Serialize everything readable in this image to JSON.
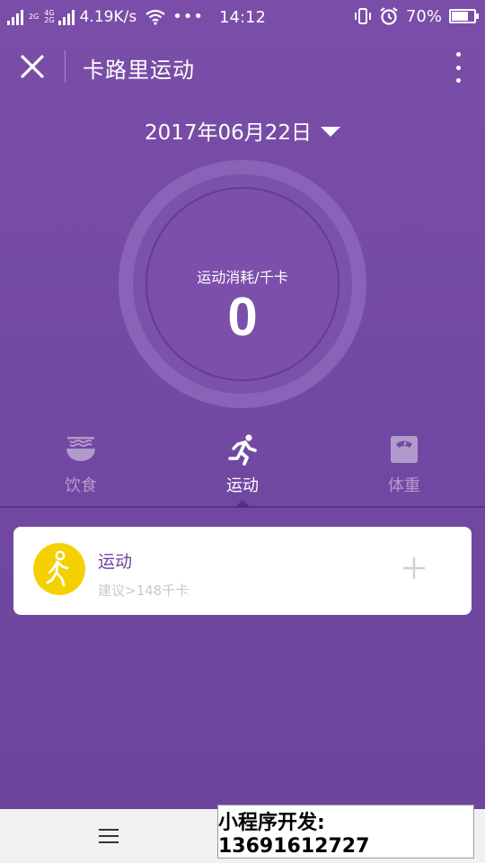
{
  "status_bar": {
    "net_top": "2G",
    "net_mid": "4G",
    "net_bot": "2G",
    "speed": "4.19K/s",
    "more": "•••",
    "time": "14:12",
    "battery_percent": "70%",
    "battery_level": 0.7
  },
  "nav": {
    "title": "卡路里运动"
  },
  "date": {
    "text": "2017年06月22日"
  },
  "ring": {
    "label": "运动消耗/千卡",
    "value": "0"
  },
  "tabs": [
    {
      "label": "饮食",
      "icon": "bowl-icon",
      "active": false
    },
    {
      "label": "运动",
      "icon": "running-icon",
      "active": true
    },
    {
      "label": "体重",
      "icon": "scale-icon",
      "active": false
    }
  ],
  "card": {
    "title": "运动",
    "subtitle": "建议>148千卡",
    "icon": "walking-icon"
  },
  "promo": {
    "text": "小程序开发: 13691612727"
  },
  "colors": {
    "background": "#734aa3",
    "ring": "#8a62b8",
    "avatar": "#f5d000",
    "card_title": "#6c449c"
  }
}
